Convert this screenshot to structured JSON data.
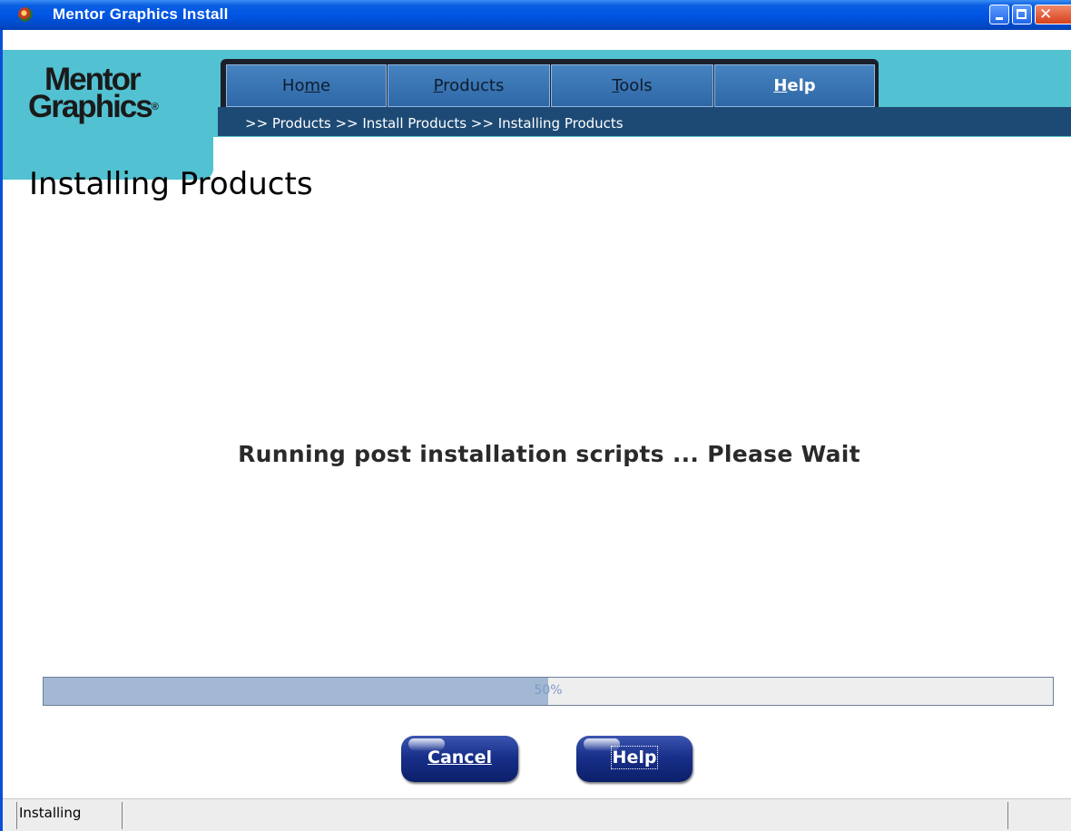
{
  "window": {
    "title": "Mentor Graphics Install",
    "controls": [
      "minimize",
      "maximize",
      "close"
    ]
  },
  "logo": {
    "line1": "Mentor",
    "line2": "Graphics",
    "mark": "®"
  },
  "nav": {
    "tabs": [
      {
        "label_pre": "Ho",
        "label_u": "m",
        "label_post": "e",
        "active": false
      },
      {
        "label_pre": "",
        "label_u": "P",
        "label_post": "roducts",
        "active": false
      },
      {
        "label_pre": "",
        "label_u": "T",
        "label_post": "ools",
        "active": false
      },
      {
        "label_pre": "",
        "label_u": "H",
        "label_post": "elp",
        "active": true
      }
    ]
  },
  "breadcrumb": ">> Products >> Install Products >> Installing Products",
  "page": {
    "title": "Installing Products",
    "status_message": "Running post installation scripts ... Please Wait"
  },
  "progress": {
    "value": 50,
    "label": "50%"
  },
  "buttons": {
    "cancel_label": "Cancel",
    "help_label": "Help"
  },
  "statusbar": {
    "text": "Installing"
  },
  "colors": {
    "titlebar": "#0055e5",
    "teal_band": "#52c1d1",
    "nav_tab": "#3a75b5",
    "breadcrumb_bar": "#1d4a74",
    "progress_fill": "#a2b8d3",
    "button": "#18308a"
  }
}
